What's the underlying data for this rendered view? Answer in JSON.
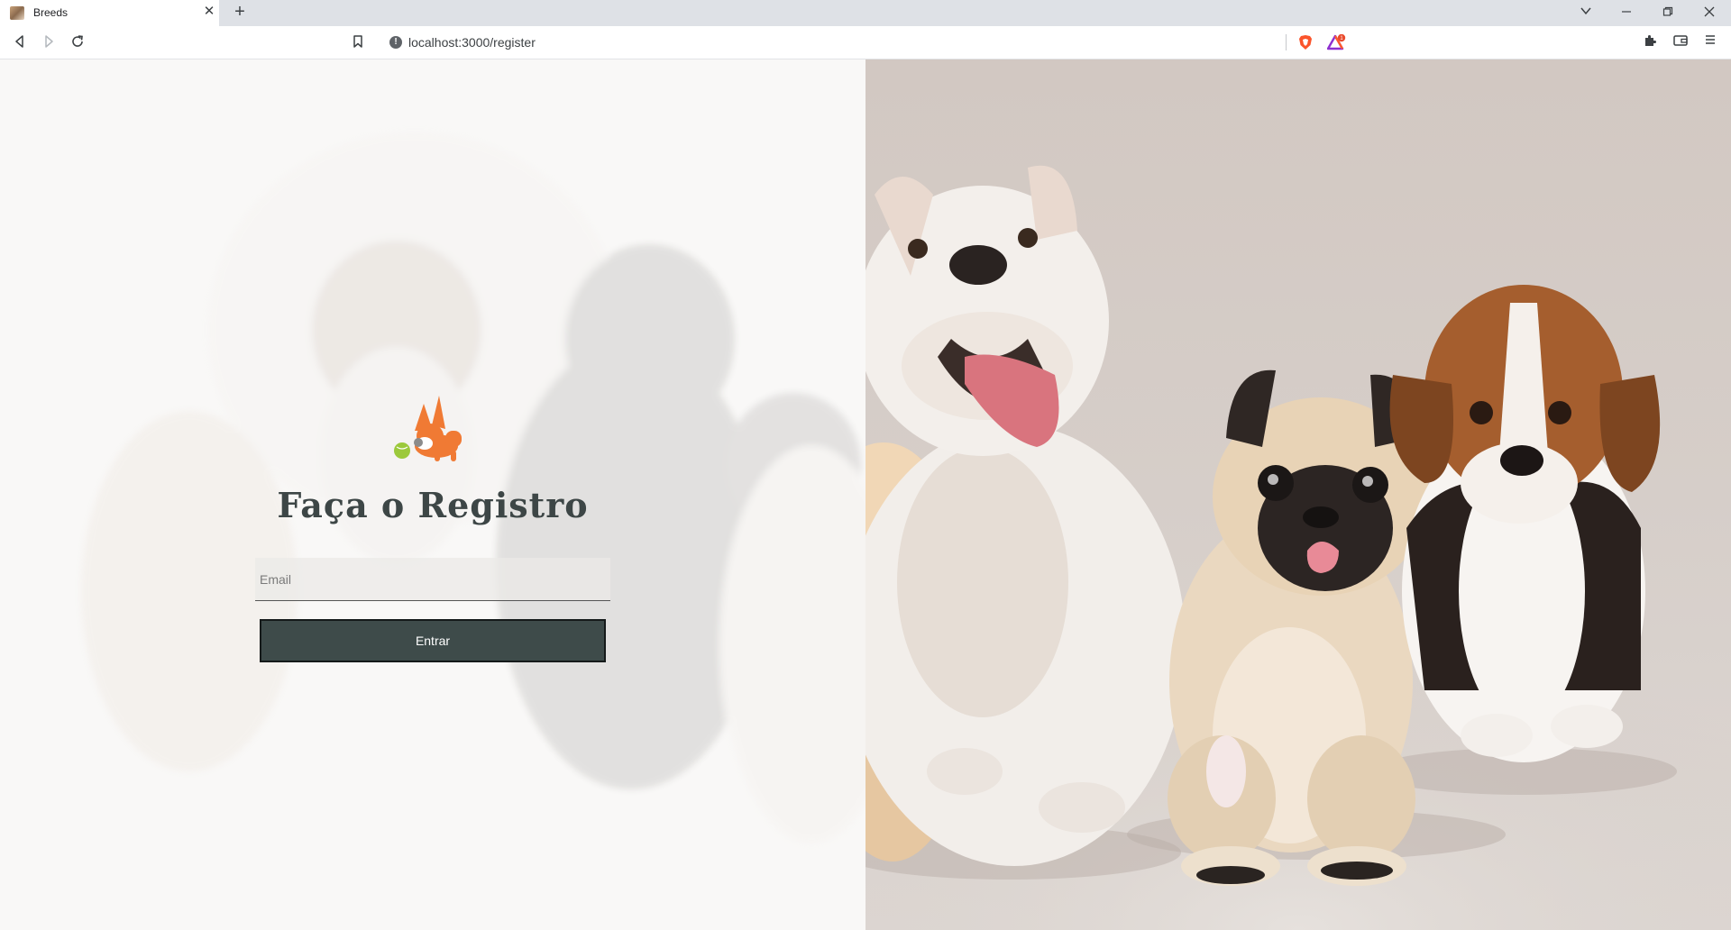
{
  "browser": {
    "tab": {
      "title": "Breeds",
      "close_glyph": "✕"
    },
    "new_tab_glyph": "+",
    "url": "localhost:3000/register",
    "rewards_badge": "1",
    "icons": [
      "back-icon",
      "forward-icon",
      "reload-icon",
      "bookmark-icon",
      "info-icon",
      "brave-shields-icon",
      "brave-rewards-icon",
      "extensions-icon",
      "wallet-icon",
      "menu-icon",
      "tab-search-icon",
      "minimize-icon",
      "restore-icon",
      "close-window-icon"
    ]
  },
  "register": {
    "title": "Faça o Registro",
    "email_placeholder": "Email",
    "email_value": "",
    "submit_label": "Entrar"
  },
  "colors": {
    "title_text": "#3d4646",
    "button_bg": "#3e4b4a",
    "button_border": "#151a1a",
    "logo_orange": "#f07a34",
    "right_bg": "#d4cbc6"
  }
}
